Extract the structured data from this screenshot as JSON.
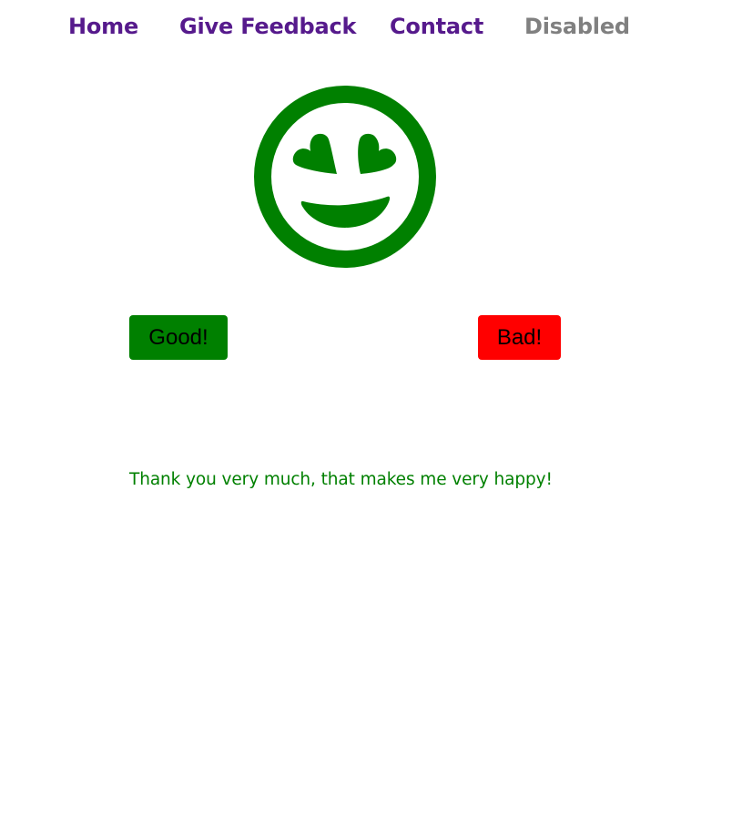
{
  "nav": {
    "items": [
      {
        "label": "Home",
        "enabled": true
      },
      {
        "label": "Give Feedback",
        "enabled": true
      },
      {
        "label": "Contact",
        "enabled": true
      },
      {
        "label": "Disabled",
        "enabled": false
      }
    ]
  },
  "feedback": {
    "face_icon": "smiling-face-with-heart-eyes-icon",
    "face_color": "#008000",
    "good_label": "Good!",
    "bad_label": "Bad!",
    "good_color": "#008000",
    "bad_color": "#ff0000",
    "message": "Thank you very much, that makes me very happy!",
    "message_color": "#008000"
  }
}
